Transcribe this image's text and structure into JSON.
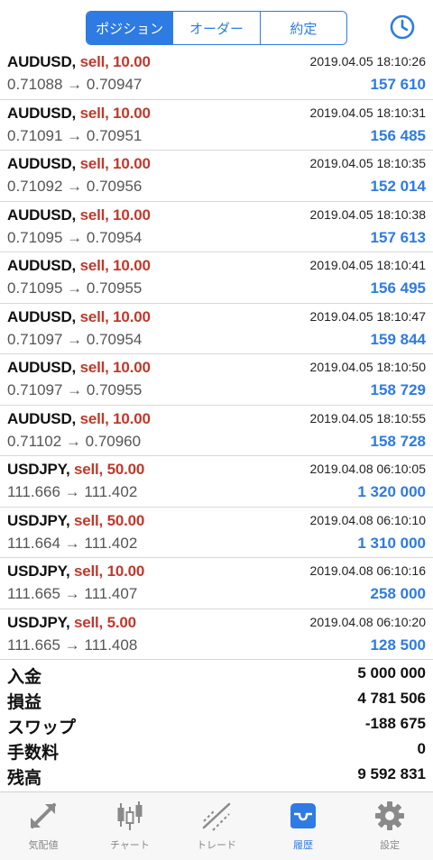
{
  "header": {
    "segments": [
      "ポジション",
      "オーダー",
      "約定"
    ],
    "active_segment": 0,
    "history_icon": "clock-icon"
  },
  "trades": [
    {
      "symbol": "AUDUSD",
      "side": "sell, 10.00",
      "time": "2019.04.05 18:10:26",
      "prices": "0.71088 → 0.70947",
      "profit": "157 610"
    },
    {
      "symbol": "AUDUSD",
      "side": "sell, 10.00",
      "time": "2019.04.05 18:10:31",
      "prices": "0.71091 → 0.70951",
      "profit": "156 485"
    },
    {
      "symbol": "AUDUSD",
      "side": "sell, 10.00",
      "time": "2019.04.05 18:10:35",
      "prices": "0.71092 → 0.70956",
      "profit": "152 014"
    },
    {
      "symbol": "AUDUSD",
      "side": "sell, 10.00",
      "time": "2019.04.05 18:10:38",
      "prices": "0.71095 → 0.70954",
      "profit": "157 613"
    },
    {
      "symbol": "AUDUSD",
      "side": "sell, 10.00",
      "time": "2019.04.05 18:10:41",
      "prices": "0.71095 → 0.70955",
      "profit": "156 495"
    },
    {
      "symbol": "AUDUSD",
      "side": "sell, 10.00",
      "time": "2019.04.05 18:10:47",
      "prices": "0.71097 → 0.70954",
      "profit": "159 844"
    },
    {
      "symbol": "AUDUSD",
      "side": "sell, 10.00",
      "time": "2019.04.05 18:10:50",
      "prices": "0.71097 → 0.70955",
      "profit": "158 729"
    },
    {
      "symbol": "AUDUSD",
      "side": "sell, 10.00",
      "time": "2019.04.05 18:10:55",
      "prices": "0.71102 → 0.70960",
      "profit": "158 728"
    },
    {
      "symbol": "USDJPY",
      "side": "sell, 50.00",
      "time": "2019.04.08 06:10:05",
      "prices": "111.666 → 111.402",
      "profit": "1 320 000"
    },
    {
      "symbol": "USDJPY",
      "side": "sell, 50.00",
      "time": "2019.04.08 06:10:10",
      "prices": "111.664 → 111.402",
      "profit": "1 310 000"
    },
    {
      "symbol": "USDJPY",
      "side": "sell, 10.00",
      "time": "2019.04.08 06:10:16",
      "prices": "111.665 → 111.407",
      "profit": "258 000"
    },
    {
      "symbol": "USDJPY",
      "side": "sell, 5.00",
      "time": "2019.04.08 06:10:20",
      "prices": "111.665 → 111.408",
      "profit": "128 500"
    }
  ],
  "summary": [
    {
      "label": "入金",
      "value": "5 000 000"
    },
    {
      "label": "損益",
      "value": "4 781 506"
    },
    {
      "label": "スワップ",
      "value": "-188 675"
    },
    {
      "label": "手数料",
      "value": "0"
    },
    {
      "label": "残高",
      "value": "9 592 831"
    }
  ],
  "tabbar": {
    "tabs": [
      {
        "label": "気配値",
        "icon": "quotes-arrows-icon"
      },
      {
        "label": "チャート",
        "icon": "candlestick-chart-icon"
      },
      {
        "label": "トレード",
        "icon": "trade-line-icon"
      },
      {
        "label": "履歴",
        "icon": "history-inbox-icon"
      },
      {
        "label": "設定",
        "icon": "gear-icon"
      }
    ],
    "active_tab": 3
  },
  "colors": {
    "accent": "#2d7be3",
    "sell": "#c0392b",
    "inactive_icon": "#8a8a8a",
    "divider": "#d8d8d8"
  }
}
